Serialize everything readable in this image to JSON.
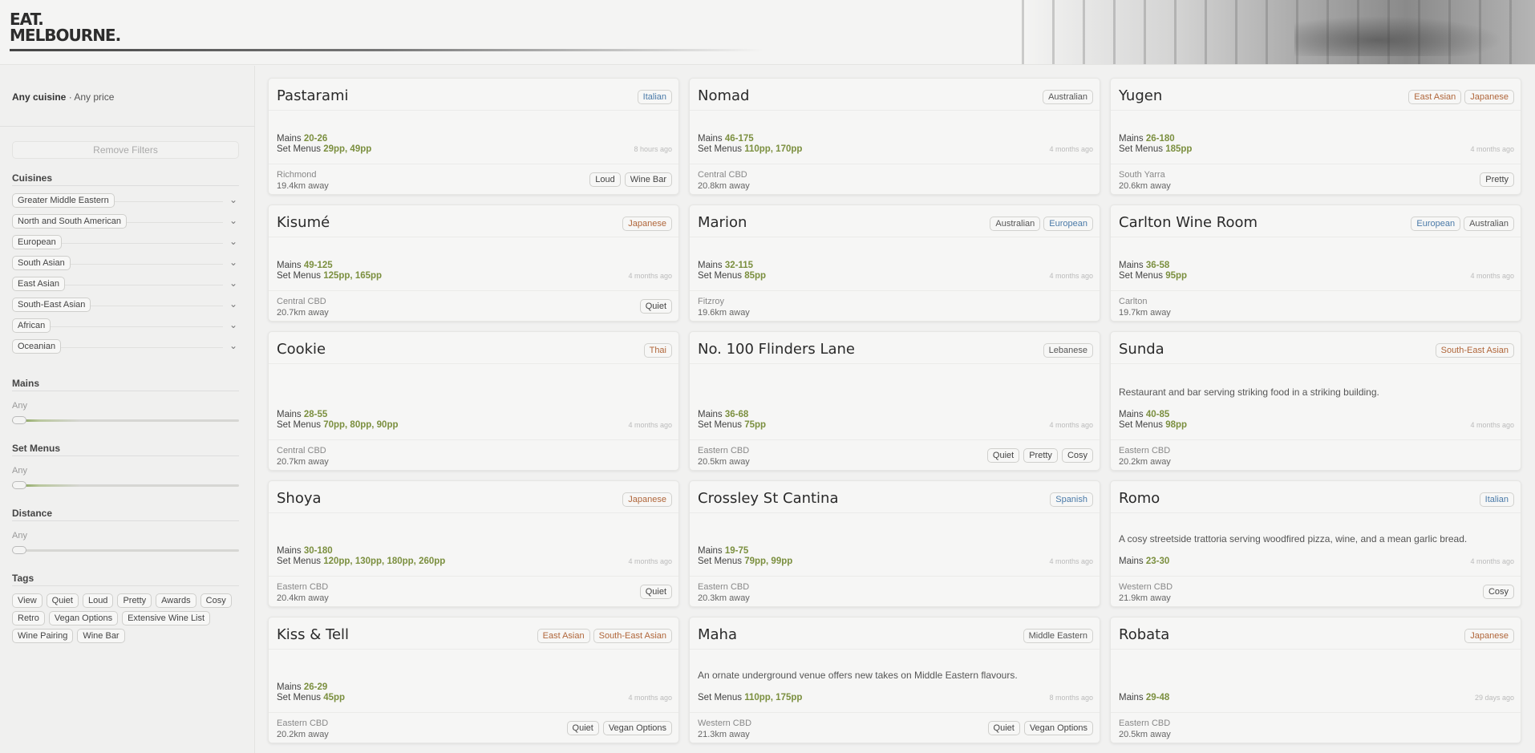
{
  "brand": {
    "line1": "EAT.",
    "line2": "MELBOURNE."
  },
  "sidebar": {
    "summary_cuisine": "Any cuisine",
    "summary_sep": " · ",
    "summary_price": "Any price",
    "remove_filters": "Remove Filters",
    "cuisines_title": "Cuisines",
    "cuisines": [
      "Greater Middle Eastern",
      "North and South American",
      "European",
      "South Asian",
      "East Asian",
      "South-East Asian",
      "African",
      "Oceanian"
    ],
    "mains_title": "Mains",
    "mains_value": "Any",
    "setmenus_title": "Set Menus",
    "setmenus_value": "Any",
    "distance_title": "Distance",
    "distance_value": "Any",
    "tags_title": "Tags",
    "tags": [
      "View",
      "Quiet",
      "Loud",
      "Pretty",
      "Awards",
      "Cosy",
      "Retro",
      "Vegan Options",
      "Extensive Wine List",
      "Wine Pairing",
      "Wine Bar"
    ]
  },
  "labels": {
    "mains": "Mains",
    "set_menus": "Set Menus"
  },
  "colors": {
    "italian": "#4a7aa8",
    "european": "#4a7aa8",
    "spanish": "#4a7aa8",
    "asian": "#b0663a",
    "neutral": "#555555",
    "price": "#7b8f3f"
  },
  "cards": [
    {
      "name": "Pastarami",
      "badges": [
        {
          "text": "Italian",
          "color": "#4a7aa8"
        }
      ],
      "desc": "",
      "mains": "20-26",
      "set_menus": "29pp, 49pp",
      "time": "8 hours ago",
      "area": "Richmond",
      "distance": "19.4km away",
      "tags": [
        "Loud",
        "Wine Bar"
      ]
    },
    {
      "name": "Nomad",
      "badges": [
        {
          "text": "Australian",
          "color": "#555555"
        }
      ],
      "desc": "",
      "mains": "46-175",
      "set_menus": "110pp, 170pp",
      "time": "4 months ago",
      "area": "Central CBD",
      "distance": "20.8km away",
      "tags": []
    },
    {
      "name": "Yugen",
      "badges": [
        {
          "text": "East Asian",
          "color": "#b0663a"
        },
        {
          "text": "Japanese",
          "color": "#b0663a"
        }
      ],
      "desc": "",
      "mains": "26-180",
      "set_menus": "185pp",
      "time": "4 months ago",
      "area": "South Yarra",
      "distance": "20.6km away",
      "tags": [
        "Pretty"
      ]
    },
    {
      "name": "Kisumé",
      "badges": [
        {
          "text": "Japanese",
          "color": "#b0663a"
        }
      ],
      "desc": "",
      "mains": "49-125",
      "set_menus": "125pp, 165pp",
      "time": "4 months ago",
      "area": "Central CBD",
      "distance": "20.7km away",
      "tags": [
        "Quiet"
      ]
    },
    {
      "name": "Marion",
      "badges": [
        {
          "text": "Australian",
          "color": "#555555"
        },
        {
          "text": "European",
          "color": "#4a7aa8"
        }
      ],
      "desc": "",
      "mains": "32-115",
      "set_menus": "85pp",
      "time": "4 months ago",
      "area": "Fitzroy",
      "distance": "19.6km away",
      "tags": []
    },
    {
      "name": "Carlton Wine Room",
      "badges": [
        {
          "text": "European",
          "color": "#4a7aa8"
        },
        {
          "text": "Australian",
          "color": "#555555"
        }
      ],
      "desc": "",
      "mains": "36-58",
      "set_menus": "95pp",
      "time": "4 months ago",
      "area": "Carlton",
      "distance": "19.7km away",
      "tags": []
    },
    {
      "name": "Cookie",
      "badges": [
        {
          "text": "Thai",
          "color": "#b0663a"
        }
      ],
      "desc": "",
      "mains": "28-55",
      "set_menus": "70pp, 80pp, 90pp",
      "time": "4 months ago",
      "area": "Central CBD",
      "distance": "20.7km away",
      "tags": []
    },
    {
      "name": "No. 100 Flinders Lane",
      "badges": [
        {
          "text": "Lebanese",
          "color": "#555555"
        }
      ],
      "desc": "",
      "mains": "36-68",
      "set_menus": "75pp",
      "time": "4 months ago",
      "area": "Eastern CBD",
      "distance": "20.5km away",
      "tags": [
        "Quiet",
        "Pretty",
        "Cosy"
      ]
    },
    {
      "name": "Sunda",
      "badges": [
        {
          "text": "South-East Asian",
          "color": "#b0663a"
        }
      ],
      "desc": "Restaurant and bar serving striking food in a striking building.",
      "mains": "40-85",
      "set_menus": "98pp",
      "time": "4 months ago",
      "area": "Eastern CBD",
      "distance": "20.2km away",
      "tags": []
    },
    {
      "name": "Shoya",
      "badges": [
        {
          "text": "Japanese",
          "color": "#b0663a"
        }
      ],
      "desc": "",
      "mains": "30-180",
      "set_menus": "120pp, 130pp, 180pp, 260pp",
      "time": "4 months ago",
      "area": "Eastern CBD",
      "distance": "20.4km away",
      "tags": [
        "Quiet"
      ]
    },
    {
      "name": "Crossley St Cantina",
      "badges": [
        {
          "text": "Spanish",
          "color": "#4a7aa8"
        }
      ],
      "desc": "",
      "mains": "19-75",
      "set_menus": "79pp, 99pp",
      "time": "4 months ago",
      "area": "Eastern CBD",
      "distance": "20.3km away",
      "tags": []
    },
    {
      "name": "Romo",
      "badges": [
        {
          "text": "Italian",
          "color": "#4a7aa8"
        }
      ],
      "desc": "A cosy streetside trattoria serving woodfired pizza, wine, and a mean garlic bread.",
      "mains": "23-30",
      "set_menus": "",
      "time": "4 months ago",
      "area": "Western CBD",
      "distance": "21.9km away",
      "tags": [
        "Cosy"
      ]
    },
    {
      "name": "Kiss & Tell",
      "badges": [
        {
          "text": "East Asian",
          "color": "#b0663a"
        },
        {
          "text": "South-East Asian",
          "color": "#b0663a"
        }
      ],
      "desc": "",
      "mains": "26-29",
      "set_menus": "45pp",
      "time": "4 months ago",
      "area": "Eastern CBD",
      "distance": "20.2km away",
      "tags": [
        "Quiet",
        "Vegan Options"
      ]
    },
    {
      "name": "Maha",
      "badges": [
        {
          "text": "Middle Eastern",
          "color": "#555555"
        }
      ],
      "desc": "An ornate underground venue offers new takes on Middle Eastern flavours.",
      "mains": "",
      "set_menus": "110pp, 175pp",
      "time": "8 months ago",
      "area": "Western CBD",
      "distance": "21.3km away",
      "tags": [
        "Quiet",
        "Vegan Options"
      ]
    },
    {
      "name": "Robata",
      "badges": [
        {
          "text": "Japanese",
          "color": "#b0663a"
        }
      ],
      "desc": "",
      "mains": "29-48",
      "set_menus": "",
      "time": "29 days ago",
      "area": "Eastern CBD",
      "distance": "20.5km away",
      "tags": []
    }
  ]
}
